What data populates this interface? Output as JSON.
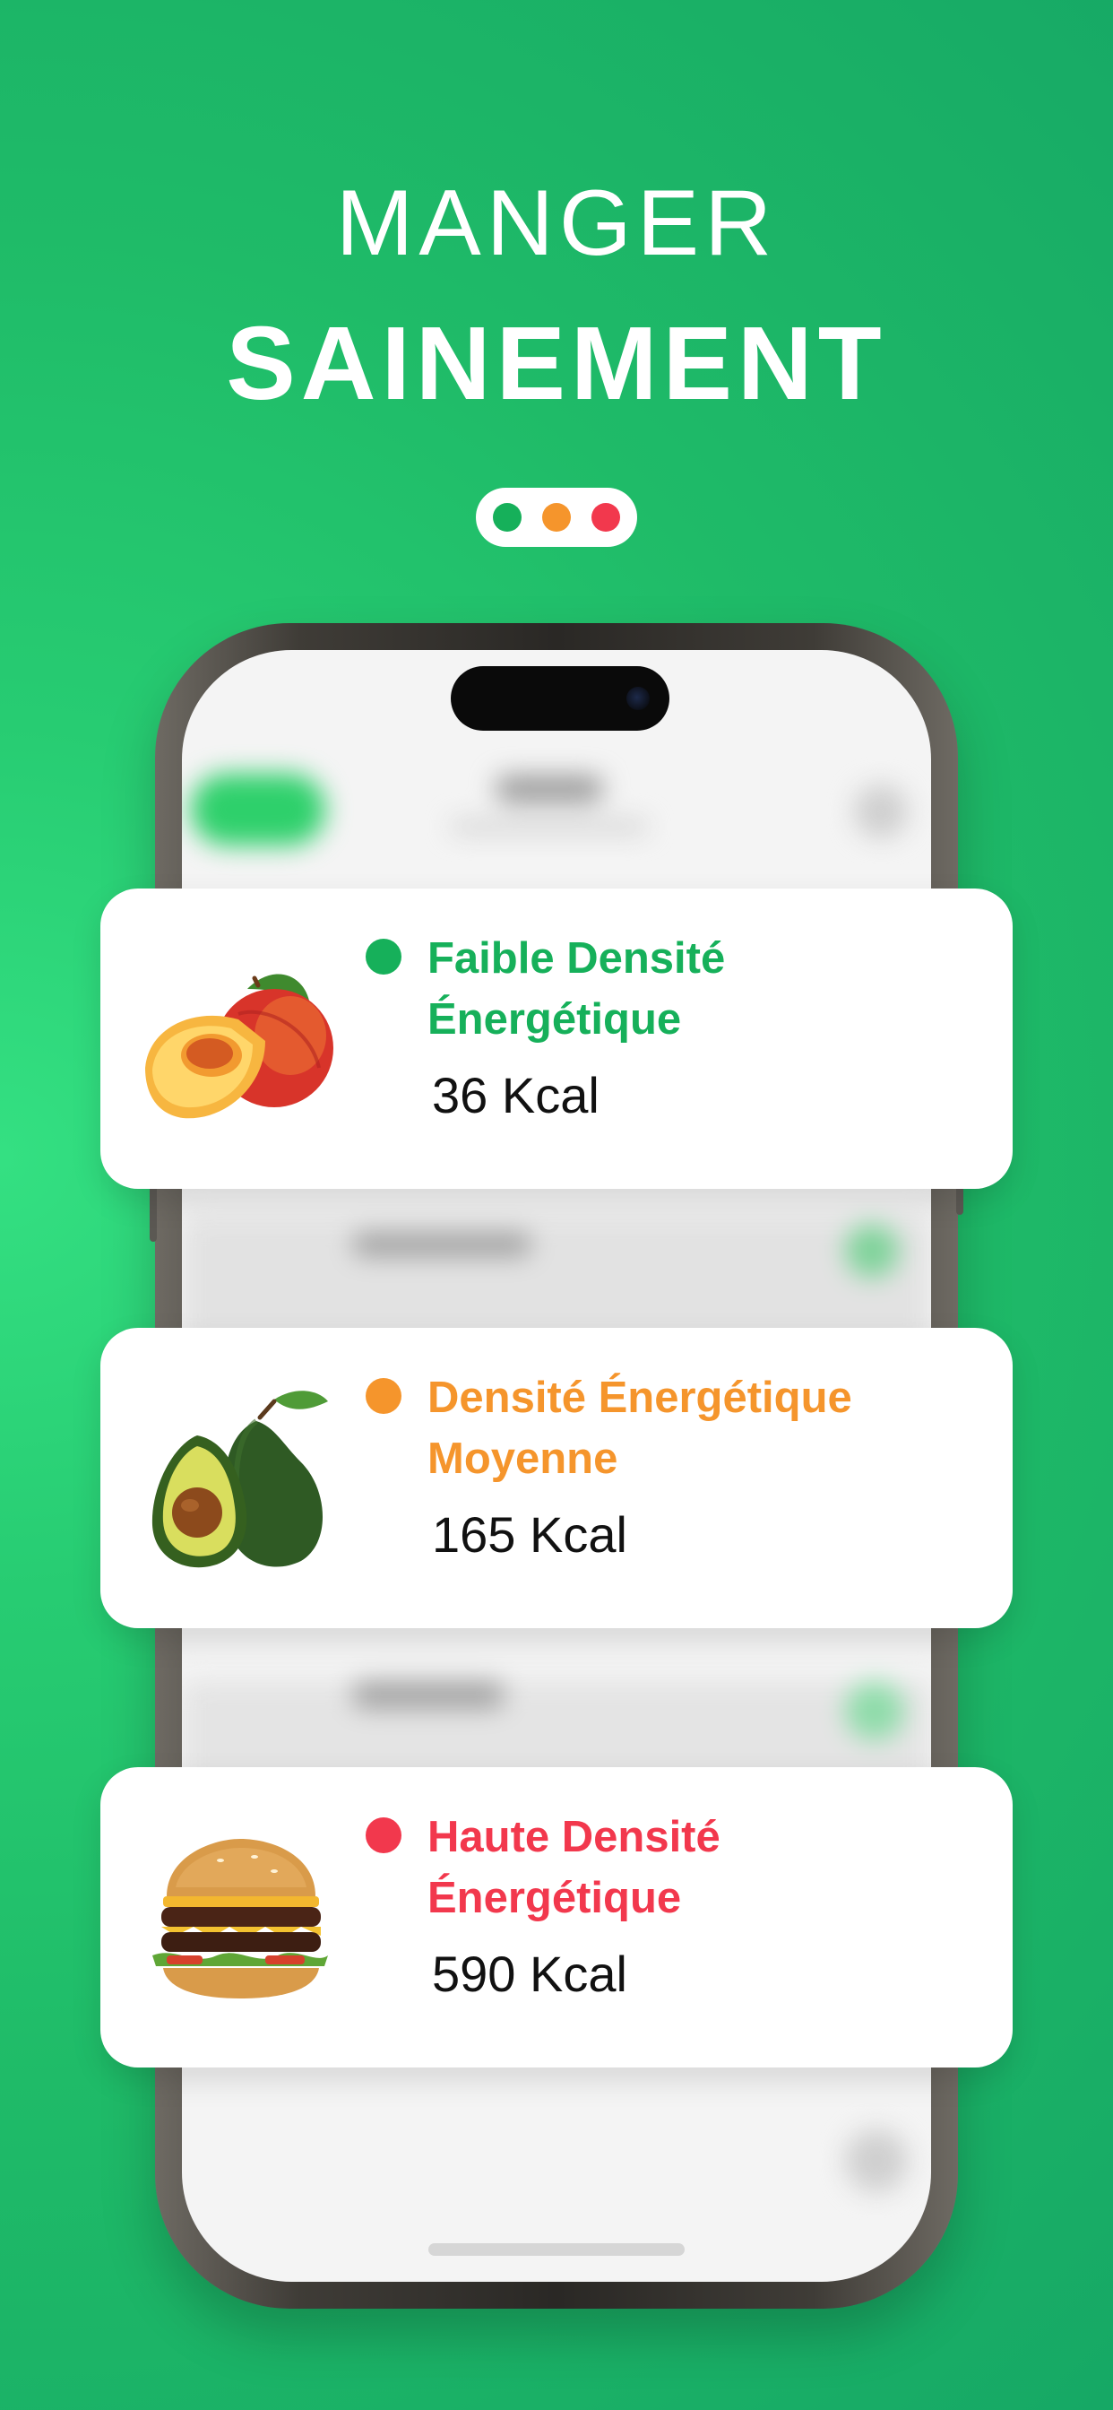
{
  "headline": {
    "line1": "MANGER",
    "line2": "SAINEMENT"
  },
  "colors": {
    "green": "#16b05a",
    "orange": "#f5952c",
    "red": "#f2384d",
    "background": "#22c56c"
  },
  "traffic_light": {
    "dots": [
      "green",
      "orange",
      "red"
    ]
  },
  "cards": [
    {
      "category_line1": "Faible Densité",
      "category_line2": "Énergétique",
      "kcal": "36 Kcal",
      "food": "peach"
    },
    {
      "category_line1": "Densité Énergétique",
      "category_line2": "Moyenne",
      "kcal": "165 Kcal",
      "food": "avocado"
    },
    {
      "category_line1": "Haute Densité",
      "category_line2": "Énergétique",
      "kcal": "590 Kcal",
      "food": "burger"
    }
  ]
}
